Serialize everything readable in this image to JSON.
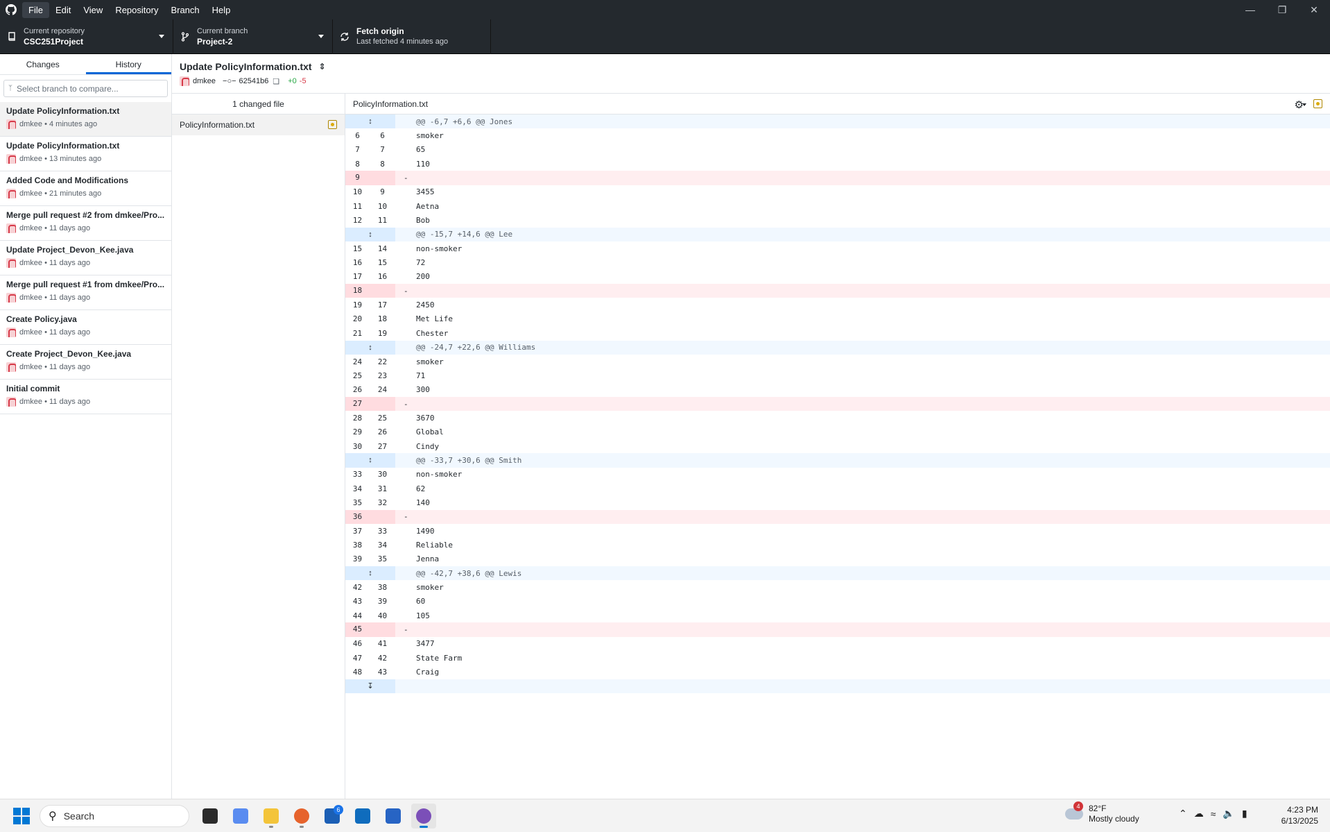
{
  "menu": [
    "File",
    "Edit",
    "View",
    "Repository",
    "Branch",
    "Help"
  ],
  "window_controls": [
    "minimize-icon",
    "restore-icon",
    "close-icon"
  ],
  "toolbar": {
    "repo_label": "Current repository",
    "repo_value": "CSC251Project",
    "branch_label": "Current branch",
    "branch_value": "Project-2",
    "fetch_label": "Fetch origin",
    "fetch_sub": "Last fetched 4 minutes ago"
  },
  "sidebar": {
    "tabs": [
      "Changes",
      "History"
    ],
    "selected_tab": "History",
    "compare_placeholder": "Select branch to compare...",
    "commits": [
      {
        "title": "Update PolicyInformation.txt",
        "meta": "dmkee • 4 minutes ago"
      },
      {
        "title": "Update PolicyInformation.txt",
        "meta": "dmkee • 13 minutes ago"
      },
      {
        "title": "Added Code and Modifications",
        "meta": "dmkee • 21 minutes ago"
      },
      {
        "title": "Merge pull request #2 from dmkee/Pro...",
        "meta": "dmkee • 11 days ago"
      },
      {
        "title": "Update Project_Devon_Kee.java",
        "meta": "dmkee • 11 days ago"
      },
      {
        "title": "Merge pull request #1 from dmkee/Pro...",
        "meta": "dmkee • 11 days ago"
      },
      {
        "title": "Create Policy.java",
        "meta": "dmkee • 11 days ago"
      },
      {
        "title": "Create Project_Devon_Kee.java",
        "meta": "dmkee • 11 days ago"
      },
      {
        "title": "Initial commit",
        "meta": "dmkee • 11 days ago"
      }
    ]
  },
  "commit": {
    "title": "Update PolicyInformation.txt",
    "author": "dmkee",
    "sha": "62541b6",
    "additions": "+0",
    "deletions": "-5"
  },
  "files": {
    "header": "1 changed file",
    "items": [
      "PolicyInformation.txt"
    ]
  },
  "diff": {
    "filename": "PolicyInformation.txt",
    "rows": [
      {
        "type": "hunk",
        "text": "@@ -6,7 +6,6 @@ Jones"
      },
      {
        "type": "ctx",
        "old": "6",
        "new": "6",
        "text": "smoker"
      },
      {
        "type": "ctx",
        "old": "7",
        "new": "7",
        "text": "65"
      },
      {
        "type": "ctx",
        "old": "8",
        "new": "8",
        "text": "110"
      },
      {
        "type": "del",
        "old": "9",
        "new": "",
        "text": "-"
      },
      {
        "type": "ctx",
        "old": "10",
        "new": "9",
        "text": "3455"
      },
      {
        "type": "ctx",
        "old": "11",
        "new": "10",
        "text": "Aetna"
      },
      {
        "type": "ctx",
        "old": "12",
        "new": "11",
        "text": "Bob"
      },
      {
        "type": "hunk",
        "text": "@@ -15,7 +14,6 @@ Lee"
      },
      {
        "type": "ctx",
        "old": "15",
        "new": "14",
        "text": "non-smoker"
      },
      {
        "type": "ctx",
        "old": "16",
        "new": "15",
        "text": "72"
      },
      {
        "type": "ctx",
        "old": "17",
        "new": "16",
        "text": "200"
      },
      {
        "type": "del",
        "old": "18",
        "new": "",
        "text": "-"
      },
      {
        "type": "ctx",
        "old": "19",
        "new": "17",
        "text": "2450"
      },
      {
        "type": "ctx",
        "old": "20",
        "new": "18",
        "text": "Met Life"
      },
      {
        "type": "ctx",
        "old": "21",
        "new": "19",
        "text": "Chester"
      },
      {
        "type": "hunk",
        "text": "@@ -24,7 +22,6 @@ Williams"
      },
      {
        "type": "ctx",
        "old": "24",
        "new": "22",
        "text": "smoker"
      },
      {
        "type": "ctx",
        "old": "25",
        "new": "23",
        "text": "71"
      },
      {
        "type": "ctx",
        "old": "26",
        "new": "24",
        "text": "300"
      },
      {
        "type": "del",
        "old": "27",
        "new": "",
        "text": "-"
      },
      {
        "type": "ctx",
        "old": "28",
        "new": "25",
        "text": "3670"
      },
      {
        "type": "ctx",
        "old": "29",
        "new": "26",
        "text": "Global"
      },
      {
        "type": "ctx",
        "old": "30",
        "new": "27",
        "text": "Cindy"
      },
      {
        "type": "hunk",
        "text": "@@ -33,7 +30,6 @@ Smith"
      },
      {
        "type": "ctx",
        "old": "33",
        "new": "30",
        "text": "non-smoker"
      },
      {
        "type": "ctx",
        "old": "34",
        "new": "31",
        "text": "62"
      },
      {
        "type": "ctx",
        "old": "35",
        "new": "32",
        "text": "140"
      },
      {
        "type": "del",
        "old": "36",
        "new": "",
        "text": "-"
      },
      {
        "type": "ctx",
        "old": "37",
        "new": "33",
        "text": "1490"
      },
      {
        "type": "ctx",
        "old": "38",
        "new": "34",
        "text": "Reliable"
      },
      {
        "type": "ctx",
        "old": "39",
        "new": "35",
        "text": "Jenna"
      },
      {
        "type": "hunk",
        "text": "@@ -42,7 +38,6 @@ Lewis"
      },
      {
        "type": "ctx",
        "old": "42",
        "new": "38",
        "text": "smoker"
      },
      {
        "type": "ctx",
        "old": "43",
        "new": "39",
        "text": "60"
      },
      {
        "type": "ctx",
        "old": "44",
        "new": "40",
        "text": "105"
      },
      {
        "type": "del",
        "old": "45",
        "new": "",
        "text": "-"
      },
      {
        "type": "ctx",
        "old": "46",
        "new": "41",
        "text": "3477"
      },
      {
        "type": "ctx",
        "old": "47",
        "new": "42",
        "text": "State Farm"
      },
      {
        "type": "ctx",
        "old": "48",
        "new": "43",
        "text": "Craig"
      },
      {
        "type": "expand",
        "text": ""
      }
    ]
  },
  "taskbar": {
    "search_placeholder": "Search",
    "apps": [
      {
        "name": "task-view-app",
        "color": "#2b2b2b"
      },
      {
        "name": "copilot-app",
        "color": "#5a8cf0"
      },
      {
        "name": "file-explorer-app",
        "color": "#f3c43a"
      },
      {
        "name": "firefox-app",
        "color": "#e6632c"
      },
      {
        "name": "l-app",
        "color": "#1b5fb5",
        "badge": "6"
      },
      {
        "name": "outlook-app",
        "color": "#0f6cbd"
      },
      {
        "name": "store-app",
        "color": "#2764c4"
      },
      {
        "name": "github-desktop-app",
        "color": "#7b4fb8"
      }
    ],
    "weather_badge": "4",
    "weather_temp": "82°F",
    "weather_desc": "Mostly cloudy",
    "time": "4:23 PM",
    "date": "6/13/2025"
  }
}
